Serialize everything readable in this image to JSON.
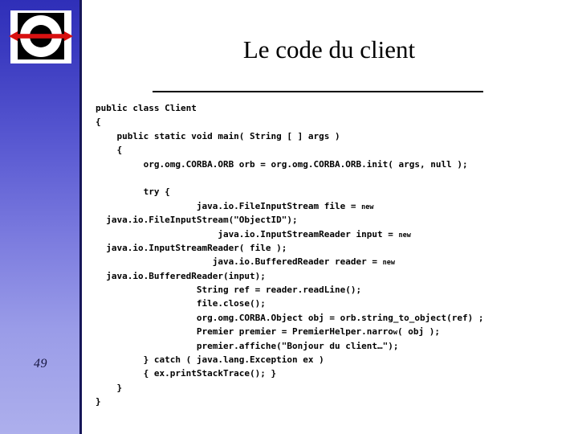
{
  "slide": {
    "title": "Le code du client",
    "page_number": "49",
    "background_color": "#ffffff",
    "sidebar": {
      "gradient_top_color": "#2f2fb8",
      "gradient_bottom_color": "#adafec",
      "border_color": "#161659"
    },
    "logo": {
      "name": "cnam-c-arrow-logo",
      "background_color": "#ffffff",
      "square_color": "#000000",
      "ring_color": "#ffffff",
      "arrow_color": "#d81111"
    },
    "divider": {
      "color": "#000000"
    }
  },
  "code": {
    "language": "java",
    "text_color": "#000000",
    "lines": [
      {
        "text": "public class Client"
      },
      {
        "text": "{"
      },
      {
        "text": "    public static void main( String [ ] args )"
      },
      {
        "text": "    {"
      },
      {
        "text": "         org.omg.CORBA.ORB orb = org.omg.CORBA.ORB.init( args, null );"
      },
      {
        "text": ""
      },
      {
        "text": "         try {"
      },
      {
        "segments": [
          {
            "text": "                   java.io.FileInputStream file = "
          },
          {
            "text": "new",
            "small": true
          }
        ]
      },
      {
        "text": "  java.io.FileInputStream(\"ObjectID\");"
      },
      {
        "segments": [
          {
            "text": "                       java.io.InputStreamReader input = "
          },
          {
            "text": "new",
            "small": true
          }
        ]
      },
      {
        "text": "  java.io.InputStreamReader( file );"
      },
      {
        "segments": [
          {
            "text": "                      java.io.BufferedReader reader = "
          },
          {
            "text": "new",
            "small": true
          }
        ]
      },
      {
        "text": "  java.io.BufferedReader(input);"
      },
      {
        "text": "                   String ref = reader.readLine();"
      },
      {
        "text": "                   file.close();"
      },
      {
        "text": "                   org.omg.CORBA.Object obj = orb.string_to_object(ref) ;"
      },
      {
        "segments": [
          {
            "text": "                   Premier premier = PremierHelper.narro"
          },
          {
            "text": "w",
            "small": true
          },
          {
            "text": "( obj );"
          }
        ]
      },
      {
        "text": "                   premier.affiche(\"Bonjour du client…\");"
      },
      {
        "text": "         } catch ( java.lang.Exception ex )"
      },
      {
        "text": "         { ex.printStackTrace(); }"
      },
      {
        "text": "    }"
      },
      {
        "text": "}"
      }
    ]
  }
}
